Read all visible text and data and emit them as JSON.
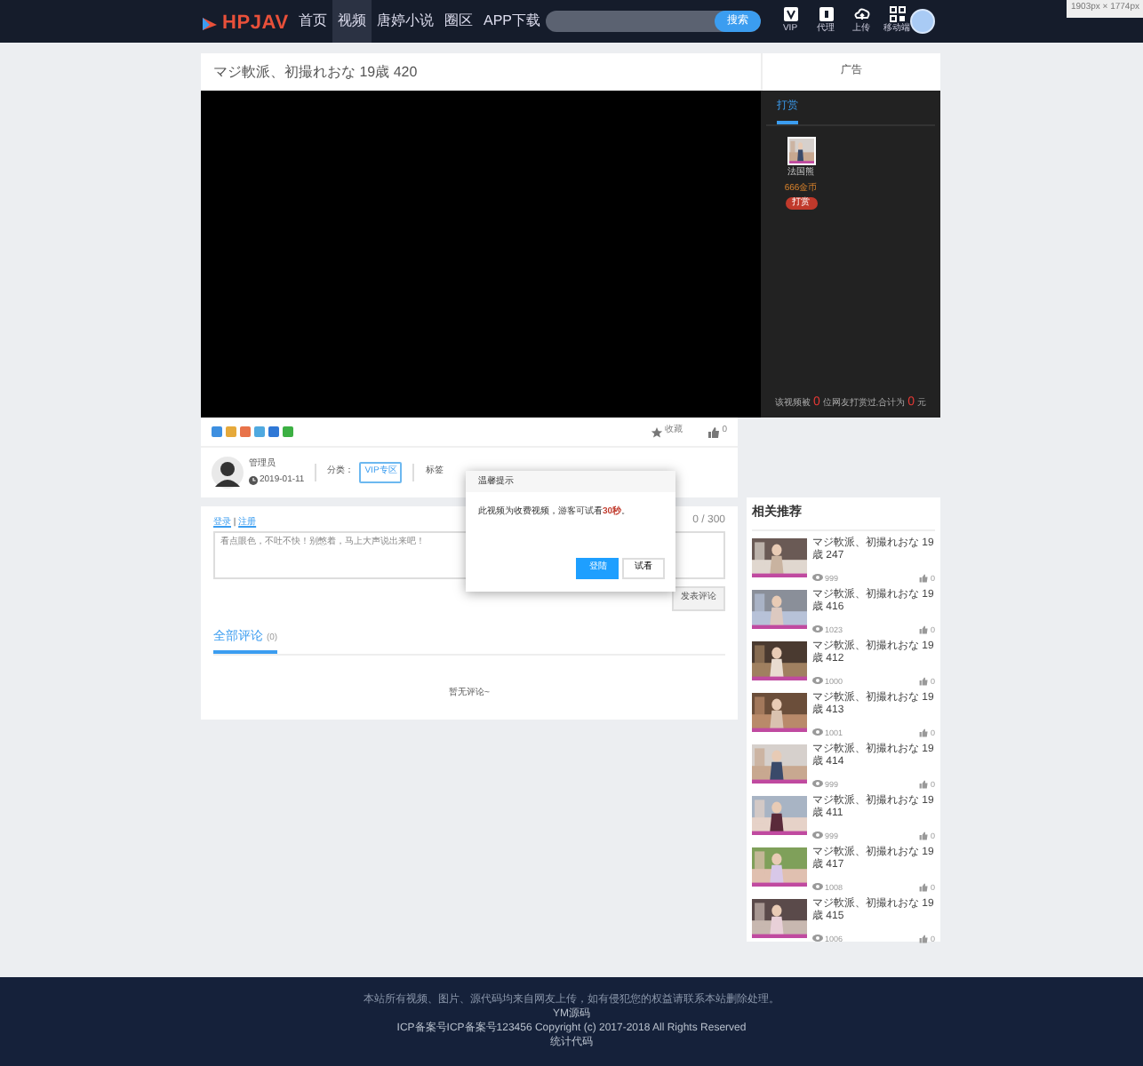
{
  "measure_overlay": "1903px × 1774px",
  "header": {
    "logo": "HPJAV",
    "nav": [
      {
        "label": "首页",
        "selected": false
      },
      {
        "label": "视频",
        "selected": true
      },
      {
        "label": "唐婷小说",
        "selected": false
      },
      {
        "label": "圈区",
        "selected": false
      },
      {
        "label": "APP下载",
        "selected": false
      }
    ],
    "search": {
      "button": "搜索"
    },
    "icons": [
      {
        "kind": "vip",
        "label": "VIP"
      },
      {
        "kind": "agent",
        "label": "代理"
      },
      {
        "kind": "upload",
        "label": "上传"
      },
      {
        "kind": "mobile",
        "label": "移动端"
      }
    ]
  },
  "video": {
    "title": "マジ軟派、初撮れおな 19歳 420"
  },
  "ad": {
    "title": "广告"
  },
  "reward_panel": {
    "tabs": [
      {
        "label": "打赏",
        "selected": true
      }
    ],
    "user": {
      "name": "法国熊",
      "coins": "666金币",
      "button": "打赏"
    },
    "summary": "该视频被 **0** 位网友打赏过,合计为 **0** 元"
  },
  "share_buttons": [
    {
      "color": "#3d8fe0"
    },
    {
      "color": "#e6a93a"
    },
    {
      "color": "#e8734a"
    },
    {
      "color": "#4fa9e0"
    },
    {
      "color": "#2f78d6"
    },
    {
      "color": "#3cb043"
    }
  ],
  "actions": [
    {
      "kind": "favorite",
      "label": "收藏"
    },
    {
      "kind": "like",
      "label": "0"
    }
  ],
  "author": {
    "name": "管理员",
    "date": "2019-01-11",
    "category_label": "分类：",
    "category": "VIP专区",
    "tags_label": "标签"
  },
  "comments": {
    "login": "登录",
    "separator": "|",
    "register": "注册",
    "counter": "0 / 300",
    "placeholder": "看点眼色，不吐不快！别憋着，马上大声说出来吧！",
    "submit": "发表评论",
    "tabs": [
      {
        "label": "全部评论",
        "count": "(0)",
        "selected": true
      }
    ],
    "empty": "暂无评论~"
  },
  "dialog": {
    "title": "温馨提示",
    "message": "此视频为收费视频，游客可试看**30秒**。",
    "buttons": [
      {
        "label": "登陆",
        "primary": true
      },
      {
        "label": "试看",
        "primary": false
      }
    ]
  },
  "related": {
    "title": "相关推荐",
    "items": [
      {
        "title": "マジ軟派、初撮れおな 19歳 247",
        "views": "999",
        "likes": "0"
      },
      {
        "title": "マジ軟派、初撮れおな 19歳 416",
        "views": "1023",
        "likes": "0"
      },
      {
        "title": "マジ軟派、初撮れおな 19歳 412",
        "views": "1000",
        "likes": "0"
      },
      {
        "title": "マジ軟派、初撮れおな 19歳 413",
        "views": "1001",
        "likes": "0"
      },
      {
        "title": "マジ軟派、初撮れおな 19歳 414",
        "views": "999",
        "likes": "0"
      },
      {
        "title": "マジ軟派、初撮れおな 19歳 411",
        "views": "999",
        "likes": "0"
      },
      {
        "title": "マジ軟派、初撮れおな 19歳 417",
        "views": "1008",
        "likes": "0"
      },
      {
        "title": "マジ軟派、初撮れおな 19歳 415",
        "views": "1006",
        "likes": "0"
      }
    ]
  },
  "footer": {
    "lines": [
      "本站所有视频、图片、源代码均来自网友上传，如有侵犯您的权益请联系本站删除处理。",
      "YM源码",
      "ICP备案号ICP备案号123456   Copyright (c) 2017-2018 All Rights Reserved",
      "统计代码"
    ]
  }
}
